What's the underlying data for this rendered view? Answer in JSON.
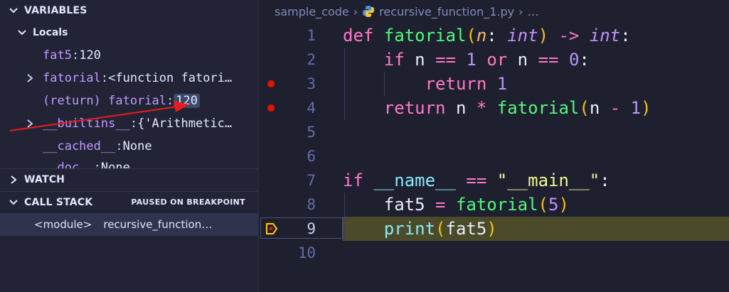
{
  "sidebar": {
    "variables_title": "VARIABLES",
    "locals_title": "Locals",
    "variables": [
      {
        "name": "fat5",
        "sep": ": ",
        "value": "120",
        "expandable": false
      },
      {
        "name": "fatorial",
        "sep": ": ",
        "value": "<function fatori…",
        "expandable": true
      },
      {
        "name": "(return) fatorial",
        "sep": ": ",
        "value": "120",
        "expandable": false,
        "highlighted": true
      },
      {
        "name": "__builtins__",
        "sep": ": ",
        "value": "{'Arithmetic…",
        "expandable": true
      },
      {
        "name": "__cached__",
        "sep": ": ",
        "value": "None",
        "expandable": false
      },
      {
        "name": "__doc__",
        "sep": ": ",
        "value": "None",
        "expandable": false
      }
    ],
    "watch_title": "WATCH",
    "callstack_title": "CALL STACK",
    "callstack_status": "PAUSED ON BREAKPOINT",
    "callstack_frame": {
      "name": "<module>",
      "file": "recursive_function…"
    }
  },
  "editor": {
    "breadcrumb": {
      "folder": "sample_code",
      "file": "recursive_function_1.py",
      "more": "…"
    },
    "line_numbers": [
      "1",
      "2",
      "3",
      "4",
      "5",
      "6",
      "7",
      "8",
      "9",
      "10"
    ],
    "current_line": 9,
    "breakpoint_lines": [
      3,
      4
    ],
    "lines": [
      [
        [
          "k",
          "def "
        ],
        [
          "f",
          "fatorial"
        ],
        [
          "b",
          "("
        ],
        [
          "p",
          "n"
        ],
        [
          "w",
          ": "
        ],
        [
          "t",
          "int"
        ],
        [
          "b",
          ")"
        ],
        [
          "w",
          " "
        ],
        [
          "o",
          "->"
        ],
        [
          "w",
          " "
        ],
        [
          "t",
          "int"
        ],
        [
          "w",
          ":"
        ]
      ],
      [
        [
          "w",
          "    "
        ],
        [
          "k",
          "if "
        ],
        [
          "w",
          "n "
        ],
        [
          "o",
          "=="
        ],
        [
          "w",
          " "
        ],
        [
          "n",
          "1"
        ],
        [
          "w",
          " "
        ],
        [
          "k",
          "or"
        ],
        [
          "w",
          " n "
        ],
        [
          "o",
          "=="
        ],
        [
          "w",
          " "
        ],
        [
          "n",
          "0"
        ],
        [
          "w",
          ":"
        ]
      ],
      [
        [
          "w",
          "        "
        ],
        [
          "k",
          "return "
        ],
        [
          "n",
          "1"
        ]
      ],
      [
        [
          "w",
          "    "
        ],
        [
          "k",
          "return "
        ],
        [
          "w",
          "n "
        ],
        [
          "o",
          "*"
        ],
        [
          "w",
          " "
        ],
        [
          "f",
          "fatorial"
        ],
        [
          "b",
          "("
        ],
        [
          "w",
          "n "
        ],
        [
          "o",
          "-"
        ],
        [
          "w",
          " "
        ],
        [
          "n",
          "1"
        ],
        [
          "b",
          ")"
        ]
      ],
      [],
      [],
      [
        [
          "k",
          "if "
        ],
        [
          "d",
          "__name__"
        ],
        [
          "w",
          " "
        ],
        [
          "o",
          "=="
        ],
        [
          "w",
          " "
        ],
        [
          "s",
          "\"__main__\""
        ],
        [
          "w",
          ":"
        ]
      ],
      [
        [
          "w",
          "    fat5 "
        ],
        [
          "o",
          "="
        ],
        [
          "w",
          " "
        ],
        [
          "f",
          "fatorial"
        ],
        [
          "b",
          "("
        ],
        [
          "n",
          "5"
        ],
        [
          "b",
          ")"
        ]
      ],
      [
        [
          "w",
          "    "
        ],
        [
          "pr",
          "print"
        ],
        [
          "b",
          "("
        ],
        [
          "w",
          "fat5"
        ],
        [
          "b",
          ")"
        ]
      ],
      []
    ]
  },
  "colors": {
    "breakpoint": "#e51400",
    "current_line_bg": "#4b4b2a",
    "annotation_arrow": "#e81c1c"
  }
}
